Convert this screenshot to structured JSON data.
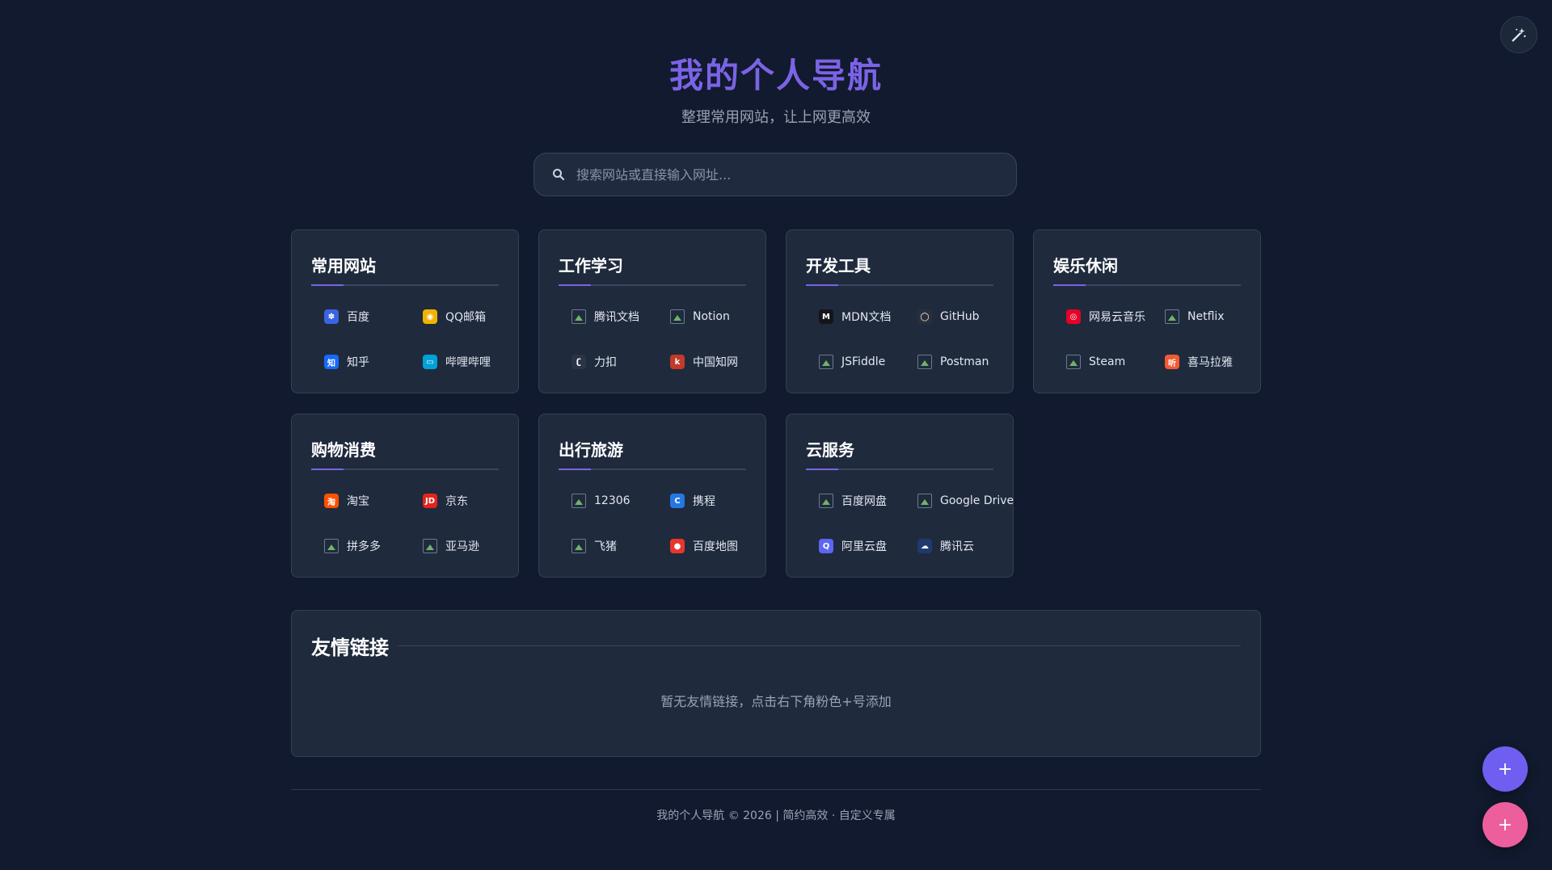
{
  "header": {
    "title": "我的个人导航",
    "subtitle": "整理常用网站，让上网更高效"
  },
  "search": {
    "placeholder": "搜索网站或直接输入网址..."
  },
  "categories": [
    {
      "title": "常用网站",
      "links": [
        {
          "label": "百度",
          "icon": "baidu-icon",
          "color": "#3b63e0",
          "glyph": "✽"
        },
        {
          "label": "QQ邮箱",
          "icon": "qq-mail-icon",
          "color": "#f0b400",
          "glyph": "◉"
        },
        {
          "label": "知乎",
          "icon": "zhihu-icon",
          "color": "#1769ff",
          "glyph": "知"
        },
        {
          "label": "哔哩哔哩",
          "icon": "bilibili-icon",
          "color": "#00a1d6",
          "glyph": "▭"
        }
      ]
    },
    {
      "title": "工作学习",
      "links": [
        {
          "label": "腾讯文档",
          "icon": "broken-image-icon",
          "color": "",
          "glyph": ""
        },
        {
          "label": "Notion",
          "icon": "broken-image-icon",
          "color": "",
          "glyph": ""
        },
        {
          "label": "力扣",
          "icon": "leetcode-icon",
          "color": "#2b3447",
          "glyph": "ʗ"
        },
        {
          "label": "中国知网",
          "icon": "cnki-icon",
          "color": "#c23a2a",
          "glyph": "k"
        }
      ]
    },
    {
      "title": "开发工具",
      "links": [
        {
          "label": "MDN文档",
          "icon": "mdn-icon",
          "color": "#15141a",
          "glyph": "M"
        },
        {
          "label": "GitHub",
          "icon": "github-icon",
          "color": "#2a2f3a",
          "glyph": "◯"
        },
        {
          "label": "JSFiddle",
          "icon": "broken-image-icon",
          "color": "",
          "glyph": ""
        },
        {
          "label": "Postman",
          "icon": "broken-image-icon",
          "color": "",
          "glyph": ""
        }
      ]
    },
    {
      "title": "娱乐休闲",
      "links": [
        {
          "label": "网易云音乐",
          "icon": "netease-music-icon",
          "color": "#e60026",
          "glyph": "◎"
        },
        {
          "label": "Netflix",
          "icon": "broken-image-icon",
          "color": "",
          "glyph": ""
        },
        {
          "label": "Steam",
          "icon": "broken-image-icon",
          "color": "",
          "glyph": ""
        },
        {
          "label": "喜马拉雅",
          "icon": "ximalaya-icon",
          "color": "#f25a32",
          "glyph": "听"
        }
      ]
    },
    {
      "title": "购物消费",
      "links": [
        {
          "label": "淘宝",
          "icon": "taobao-icon",
          "color": "#ff5000",
          "glyph": "淘"
        },
        {
          "label": "京东",
          "icon": "jd-icon",
          "color": "#e1251b",
          "glyph": "JD"
        },
        {
          "label": "拼多多",
          "icon": "broken-image-icon",
          "color": "",
          "glyph": ""
        },
        {
          "label": "亚马逊",
          "icon": "broken-image-icon",
          "color": "",
          "glyph": ""
        }
      ]
    },
    {
      "title": "出行旅游",
      "links": [
        {
          "label": "12306",
          "icon": "broken-image-icon",
          "color": "",
          "glyph": ""
        },
        {
          "label": "携程",
          "icon": "ctrip-icon",
          "color": "#2577e3",
          "glyph": "C"
        },
        {
          "label": "飞猪",
          "icon": "broken-image-icon",
          "color": "",
          "glyph": ""
        },
        {
          "label": "百度地图",
          "icon": "baidu-map-icon",
          "color": "#e8362b",
          "glyph": "●"
        }
      ]
    },
    {
      "title": "云服务",
      "links": [
        {
          "label": "百度网盘",
          "icon": "broken-image-icon",
          "color": "",
          "glyph": ""
        },
        {
          "label": "Google Drive",
          "icon": "broken-image-icon",
          "color": "",
          "glyph": ""
        },
        {
          "label": "阿里云盘",
          "icon": "aliyun-drive-icon",
          "color": "#5b67f4",
          "glyph": "Q"
        },
        {
          "label": "腾讯云",
          "icon": "tencent-cloud-icon",
          "color": "#1e3a6e",
          "glyph": "☁"
        }
      ]
    }
  ],
  "friends": {
    "title": "友情链接",
    "empty_text": "暂无友情链接，点击右下角粉色+号添加"
  },
  "footer": {
    "text": "我的个人导航 © 2026 | 简约高效 · 自定义专属"
  },
  "fab": {
    "add_site_label": "+",
    "add_friend_label": "+"
  },
  "colors": {
    "accent": "#7b63e6",
    "background": "#111a2e",
    "card": "#1f2a3d",
    "pink": "#ec5f9c"
  }
}
